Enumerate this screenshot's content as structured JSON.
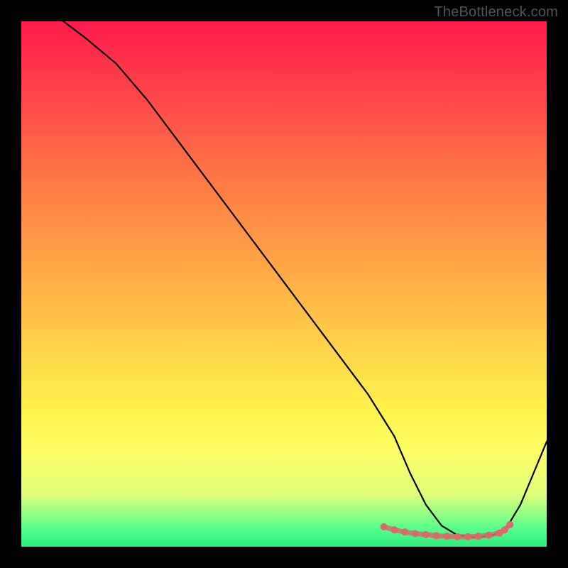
{
  "watermark": "TheBottleneck.com",
  "chart_data": {
    "type": "line",
    "title": "",
    "xlabel": "",
    "ylabel": "",
    "xlim": [
      0,
      100
    ],
    "ylim": [
      0,
      100
    ],
    "series": [
      {
        "name": "curve",
        "x": [
          8,
          12,
          18,
          24,
          30,
          36,
          42,
          48,
          54,
          60,
          66,
          71,
          74,
          77,
          80,
          83,
          86,
          89,
          92,
          95,
          100
        ],
        "values": [
          100,
          97,
          92,
          85,
          77,
          69,
          61,
          53,
          45,
          37,
          29,
          21,
          14,
          8,
          4,
          2.2,
          1.8,
          2.0,
          3,
          8,
          20
        ]
      }
    ],
    "markers": {
      "name": "highlight-dots",
      "color_hex": "#d96a6a",
      "x": [
        69,
        71,
        73,
        75,
        77,
        79,
        81,
        83,
        85,
        87,
        89,
        91,
        92,
        93
      ],
      "values": [
        3.8,
        3.2,
        2.8,
        2.5,
        2.3,
        2.1,
        2.0,
        1.9,
        1.9,
        2.0,
        2.2,
        2.6,
        3.2,
        4.2
      ]
    },
    "gradient_colors": {
      "top": "#ff1a4d",
      "mid": "#ffd348",
      "bottom": "#30e97c"
    }
  }
}
